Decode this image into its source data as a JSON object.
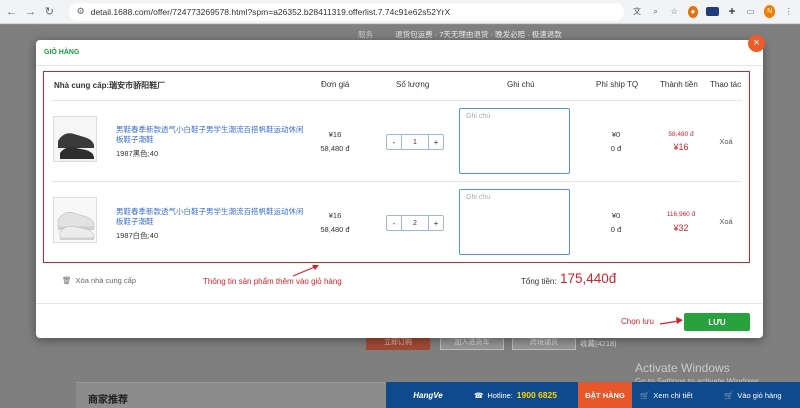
{
  "browser": {
    "url": "detail.1688.com/offer/724773269578.html?spm=a26352.b28411319.offerlist.7.74c91e62s52YrX",
    "profile_initial": "N"
  },
  "behind": {
    "service_label": "服务",
    "service_text": "退货包运费 · 7天无理由退货 · 晚发必赔 · 极速退款",
    "btn1": "立即订购",
    "btn2": "加入进货车",
    "btn3": "跨境铺货",
    "favorite": "收藏(4218)",
    "watermark_title": "Activate Windows",
    "watermark_sub": "Go to Settings to activate Windows.",
    "merchant_recommend": "商家推荐",
    "hangve": {
      "logo": "HangVe",
      "hotline_label": "Hotline:",
      "hotline": "1900 6825",
      "order": "ĐẶT HÀNG",
      "cart_detail": "Xem chi tiết",
      "cart": "Vào giỏ hàng"
    }
  },
  "modal": {
    "title": "GIỎ HÀNG",
    "columns": {
      "supplier": "Nhà cung cấp:瑞安市骄阳鞋厂",
      "price": "Đơn giá",
      "qty": "Số lượng",
      "note": "Ghi chú",
      "ship": "Phí ship TQ",
      "total": "Thành tiền",
      "action": "Thao tác"
    },
    "items": [
      {
        "name": "男鞋春季新款透气小白鞋子男学生潮流百搭帆鞋运动休闲板鞋子潮鞋",
        "variant": "1987黑色;40",
        "price_cny": "¥16",
        "price_vnd": "58,480 đ",
        "qty_minus": "-",
        "qty": "1",
        "qty_plus": "+",
        "note_placeholder": "Ghi chú",
        "ship_cny": "¥0",
        "ship_vnd": "0 đ",
        "total_vnd": "58,480 đ",
        "total_cny": "¥16",
        "action": "Xoá",
        "shoe_color": "#3a3a3a"
      },
      {
        "name": "男鞋春季新款透气小白鞋子男学生潮流百搭帆鞋运动休闲板鞋子潮鞋",
        "variant": "1987白色;40",
        "price_cny": "¥16",
        "price_vnd": "58,480 đ",
        "qty_minus": "-",
        "qty": "2",
        "qty_plus": "+",
        "note_placeholder": "Ghi chú",
        "ship_cny": "¥0",
        "ship_vnd": "0 đ",
        "total_vnd": "116,960 đ",
        "total_cny": "¥32",
        "action": "Xoá",
        "shoe_color": "#e8e8e8"
      }
    ],
    "remove_supplier": "Xóa nhà cung cấp",
    "annotation_products": "Thông tin sản phẩm thêm vào giỏ hàng",
    "total_label": "Tổng tiền:",
    "total_value": "175,440đ",
    "annotation_save": "Chọn lưu",
    "save_button": "LƯU",
    "colors": {
      "accent_green": "#27a23c",
      "close_orange": "#f05a28",
      "highlight_red": "#d2232a",
      "link_blue": "#3a6fd0"
    }
  }
}
